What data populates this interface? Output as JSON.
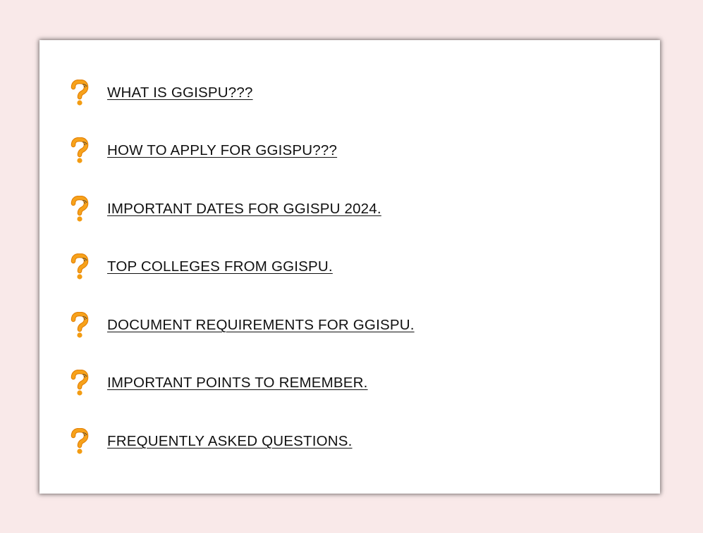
{
  "icon_name": "question-mark-icon",
  "icon_color": "#f39c12",
  "items": [
    {
      "label": "WHAT IS GGISPU???"
    },
    {
      "label": "HOW TO APPLY FOR GGISPU???"
    },
    {
      "label": "IMPORTANT DATES FOR GGISPU 2024."
    },
    {
      "label": "TOP COLLEGES FROM GGISPU."
    },
    {
      "label": "DOCUMENT REQUIREMENTS FOR GGISPU."
    },
    {
      "label": "IMPORTANT POINTS TO REMEMBER."
    },
    {
      "label": "FREQUENTLY ASKED QUESTIONS."
    }
  ]
}
